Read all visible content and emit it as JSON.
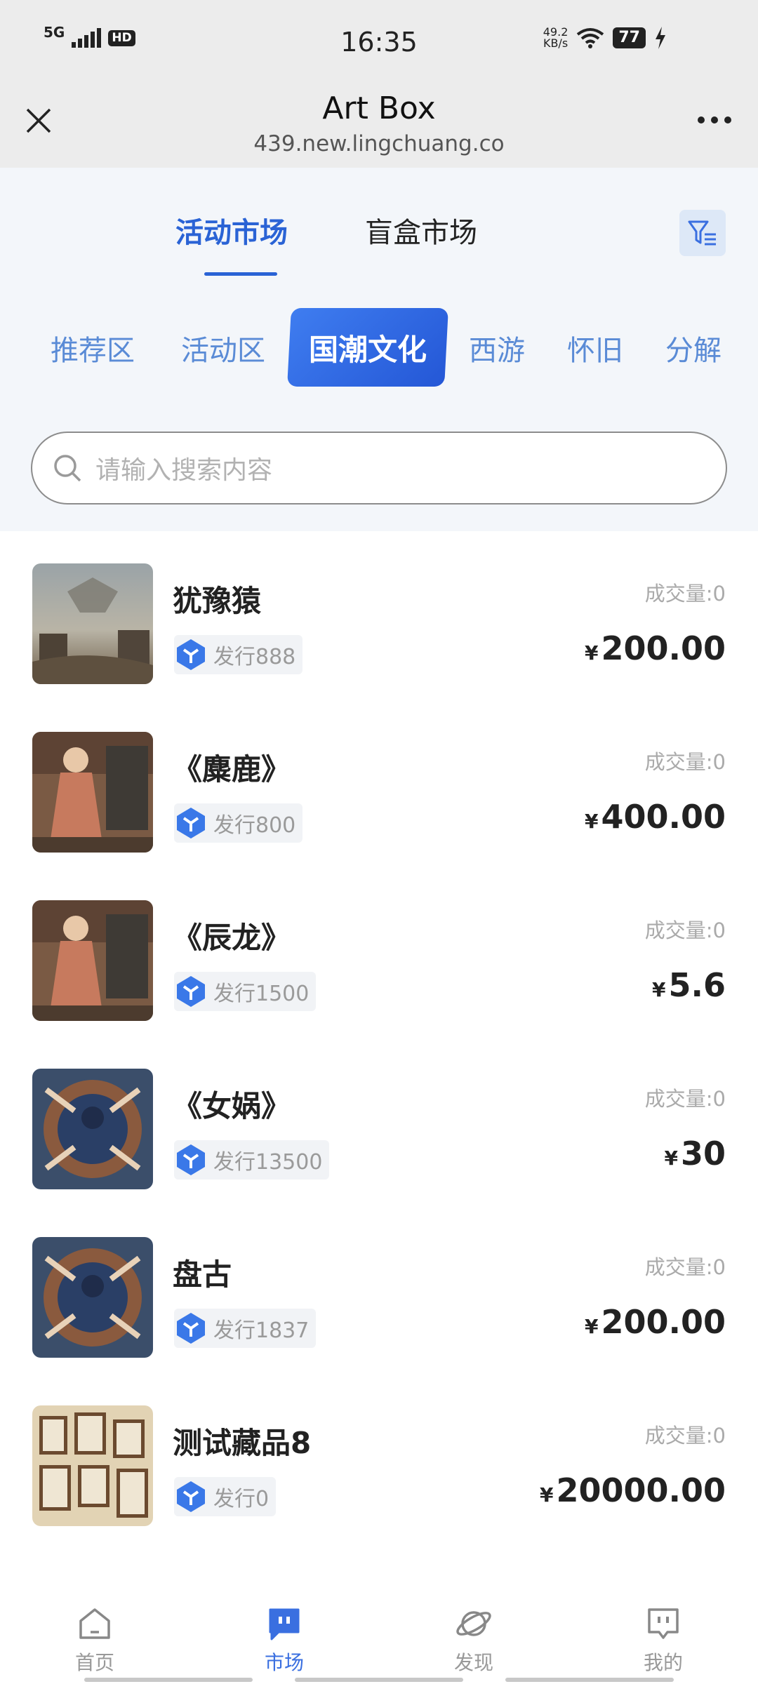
{
  "status_bar": {
    "network": "5G",
    "hd_label": "HD",
    "time": "16:35",
    "speed_value": "49.2",
    "speed_unit": "KB/s",
    "battery": "77"
  },
  "title_bar": {
    "title": "Art Box",
    "url": "439.new.lingchuang.co"
  },
  "market_tabs": [
    {
      "label": "活动市场",
      "active": true
    },
    {
      "label": "盲盒市场",
      "active": false
    }
  ],
  "categories": [
    {
      "label": "推荐区",
      "active": false
    },
    {
      "label": "活动区",
      "active": false
    },
    {
      "label": "国潮文化",
      "active": true
    },
    {
      "label": "西游",
      "active": false
    },
    {
      "label": "怀旧",
      "active": false
    },
    {
      "label": "分解",
      "active": false
    }
  ],
  "search": {
    "placeholder": "请输入搜索内容"
  },
  "items": [
    {
      "name": "犹豫猿",
      "issue": "发行888",
      "volume": "成交量:0",
      "currency": "¥",
      "price": "200.00"
    },
    {
      "name": "《麋鹿》",
      "issue": "发行800",
      "volume": "成交量:0",
      "currency": "¥",
      "price": "400.00"
    },
    {
      "name": "《辰龙》",
      "issue": "发行1500",
      "volume": "成交量:0",
      "currency": "¥",
      "price": "5.6"
    },
    {
      "name": "《女娲》",
      "issue": "发行13500",
      "volume": "成交量:0",
      "currency": "¥",
      "price": "30"
    },
    {
      "name": "盘古",
      "issue": "发行1837",
      "volume": "成交量:0",
      "currency": "¥",
      "price": "200.00"
    },
    {
      "name": "测试藏品8",
      "issue": "发行0",
      "volume": "成交量:0",
      "currency": "¥",
      "price": "20000.00"
    }
  ],
  "bottom_nav": [
    {
      "label": "首页",
      "icon": "home-icon",
      "active": false
    },
    {
      "label": "市场",
      "icon": "market-icon",
      "active": true
    },
    {
      "label": "发现",
      "icon": "planet-icon",
      "active": false
    },
    {
      "label": "我的",
      "icon": "profile-icon",
      "active": false
    }
  ],
  "colors": {
    "accent": "#2a63d5",
    "category_text": "#5a8bd6",
    "header_bg": "#f3f6fa",
    "titlebar_bg": "#ececec"
  }
}
